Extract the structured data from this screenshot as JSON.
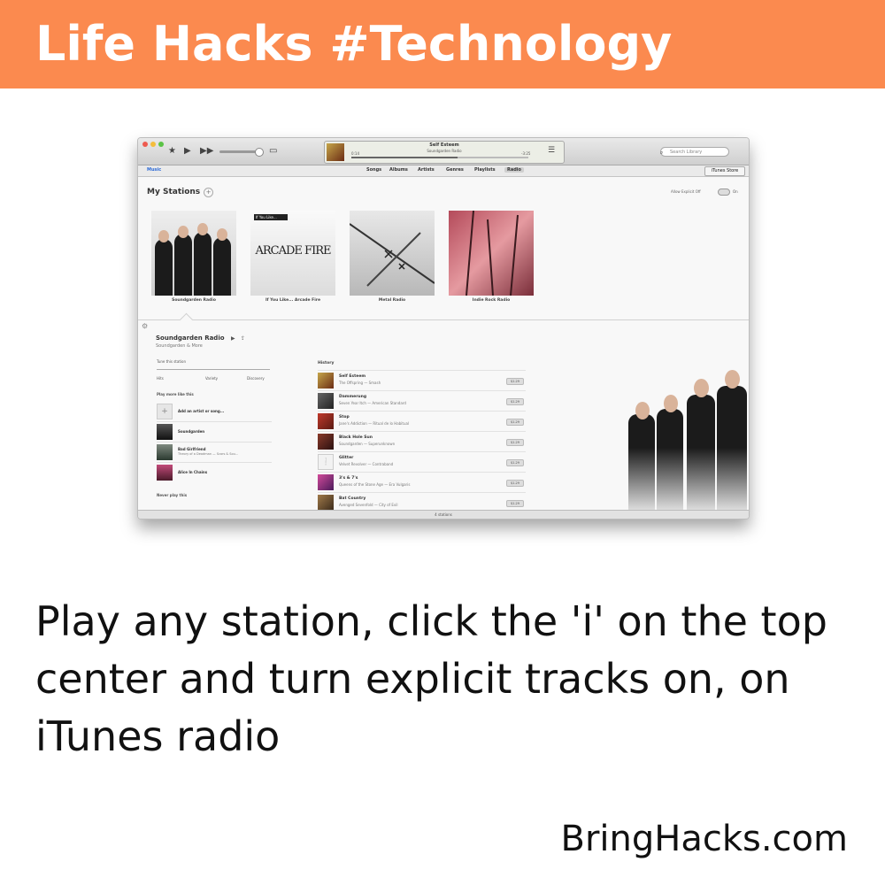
{
  "banner": {
    "title": "Life Hacks #Technology",
    "color": "#fb8a4f"
  },
  "itunes": {
    "now_playing": {
      "title": "Self Esteem",
      "subtitle": "Soundgarden Radio",
      "elapsed": "0:14",
      "remaining": "-3:25"
    },
    "search_placeholder": "Search Library",
    "library_label": "Music",
    "nav_tabs": [
      "Songs",
      "Albums",
      "Artists",
      "Genres",
      "Playlists",
      "Radio"
    ],
    "active_tab": "Radio",
    "store_button": "iTunes Store",
    "stations_heading": "My Stations",
    "allow_explicit": "Allow Explicit   Off",
    "toggle_on": "On",
    "stations": [
      {
        "name": "Soundgarden Radio"
      },
      {
        "name": "If You Like... Arcade Fire",
        "art_text": "ARCADE FIRE",
        "badge": "If You Like..."
      },
      {
        "name": "Metal Radio"
      },
      {
        "name": "Indie Rock Radio"
      }
    ],
    "detail": {
      "title": "Soundgarden Radio",
      "subtitle": "Soundgarden & More",
      "tune_label": "Tune this station",
      "tune_options": [
        "Hits",
        "Variety",
        "Discovery"
      ],
      "play_more_label": "Play more like this",
      "add_artist": "Add an artist or song...",
      "artists": [
        {
          "name": "Soundgarden",
          "sub": ""
        },
        {
          "name": "Bad Girlfriend",
          "sub": "Theory of a Deadman — Scars & Sou..."
        },
        {
          "name": "Alice In Chains",
          "sub": ""
        }
      ],
      "never_play_label": "Never play this"
    },
    "history_label": "History",
    "history": [
      {
        "title": "Self Esteem",
        "sub": "The Offspring — Smash",
        "price": "$1.29"
      },
      {
        "title": "Dammerung",
        "sub": "Seven Year Itch — American Standard",
        "price": "$1.29"
      },
      {
        "title": "Stop",
        "sub": "Jane's Addiction — Ritual de lo Habitual",
        "price": "$1.29"
      },
      {
        "title": "Black Hole Sun",
        "sub": "Soundgarden — Superunknown",
        "price": "$1.29"
      },
      {
        "title": "Glitter",
        "sub": "Velvet Revolver — Contraband",
        "price": "$1.29"
      },
      {
        "title": "3's & 7's",
        "sub": "Queens of the Stone Age — Era Vulgaris",
        "price": "$1.29"
      },
      {
        "title": "Bat Country",
        "sub": "Avenged Sevenfold — City of Evil",
        "price": "$1.29"
      }
    ],
    "status": "4 stations"
  },
  "caption": "Play any station, click the 'i' on the top center and turn explicit tracks on, on iTunes radio",
  "footer": "BringHacks.com"
}
